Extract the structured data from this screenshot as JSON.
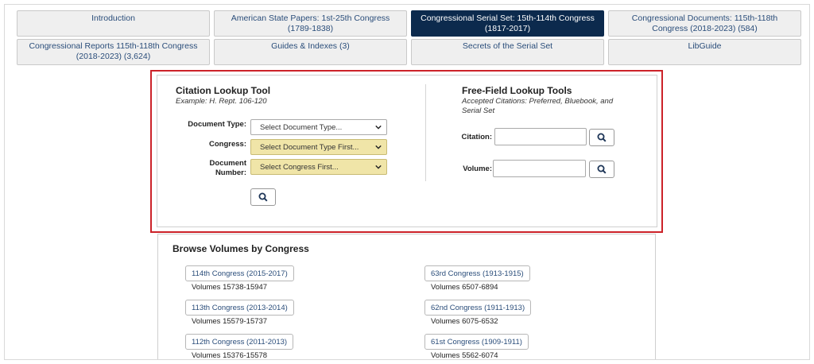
{
  "tabs": [
    {
      "label": "Introduction"
    },
    {
      "label": "American State Papers: 1st-25th Congress (1789-1838)"
    },
    {
      "label": "Congressional Serial Set: 15th-114th Congress (1817-2017)"
    },
    {
      "label": "Congressional Documents: 115th-118th Congress (2018-2023) (584)"
    },
    {
      "label": "Congressional Reports 115th-118th Congress (2018-2023) (3,624)"
    },
    {
      "label": "Guides & Indexes (3)"
    },
    {
      "label": "Secrets of the Serial Set"
    },
    {
      "label": "LibGuide"
    }
  ],
  "citation_tool": {
    "title": "Citation Lookup Tool",
    "example": "Example: H. Rept. 106-120",
    "document_type_label": "Document Type:",
    "document_type_value": "Select Document Type...",
    "congress_label": "Congress:",
    "congress_value": "Select Document Type First...",
    "document_number_label": "Document Number:",
    "document_number_value": "Select Congress First..."
  },
  "free_field": {
    "title": "Free-Field Lookup Tools",
    "accepted": "Accepted Citations: Preferred, Bluebook, and Serial Set",
    "citation_label": "Citation:",
    "citation_value": "",
    "volume_label": "Volume:",
    "volume_value": ""
  },
  "browse": {
    "title": "Browse Volumes by Congress",
    "left": [
      {
        "congress": "114th Congress (2015-2017)",
        "volumes": "Volumes 15738-15947"
      },
      {
        "congress": "113th Congress (2013-2014)",
        "volumes": "Volumes 15579-15737"
      },
      {
        "congress": "112th Congress (2011-2013)",
        "volumes": "Volumes 15376-15578"
      }
    ],
    "right": [
      {
        "congress": "63rd Congress (1913-1915)",
        "volumes": "Volumes 6507-6894"
      },
      {
        "congress": "62nd Congress (1911-1913)",
        "volumes": "Volumes 6075-6532"
      },
      {
        "congress": "61st Congress (1909-1911)",
        "volumes": "Volumes 5562-6074"
      }
    ]
  },
  "colors": {
    "active_tab": "#0c2a4d",
    "highlight": "#cc2229",
    "link": "#2a4d7a",
    "select_yellow": "#f0e5a8"
  },
  "icons": {
    "search": "search-icon",
    "dropdown": "chevron-down-icon"
  }
}
